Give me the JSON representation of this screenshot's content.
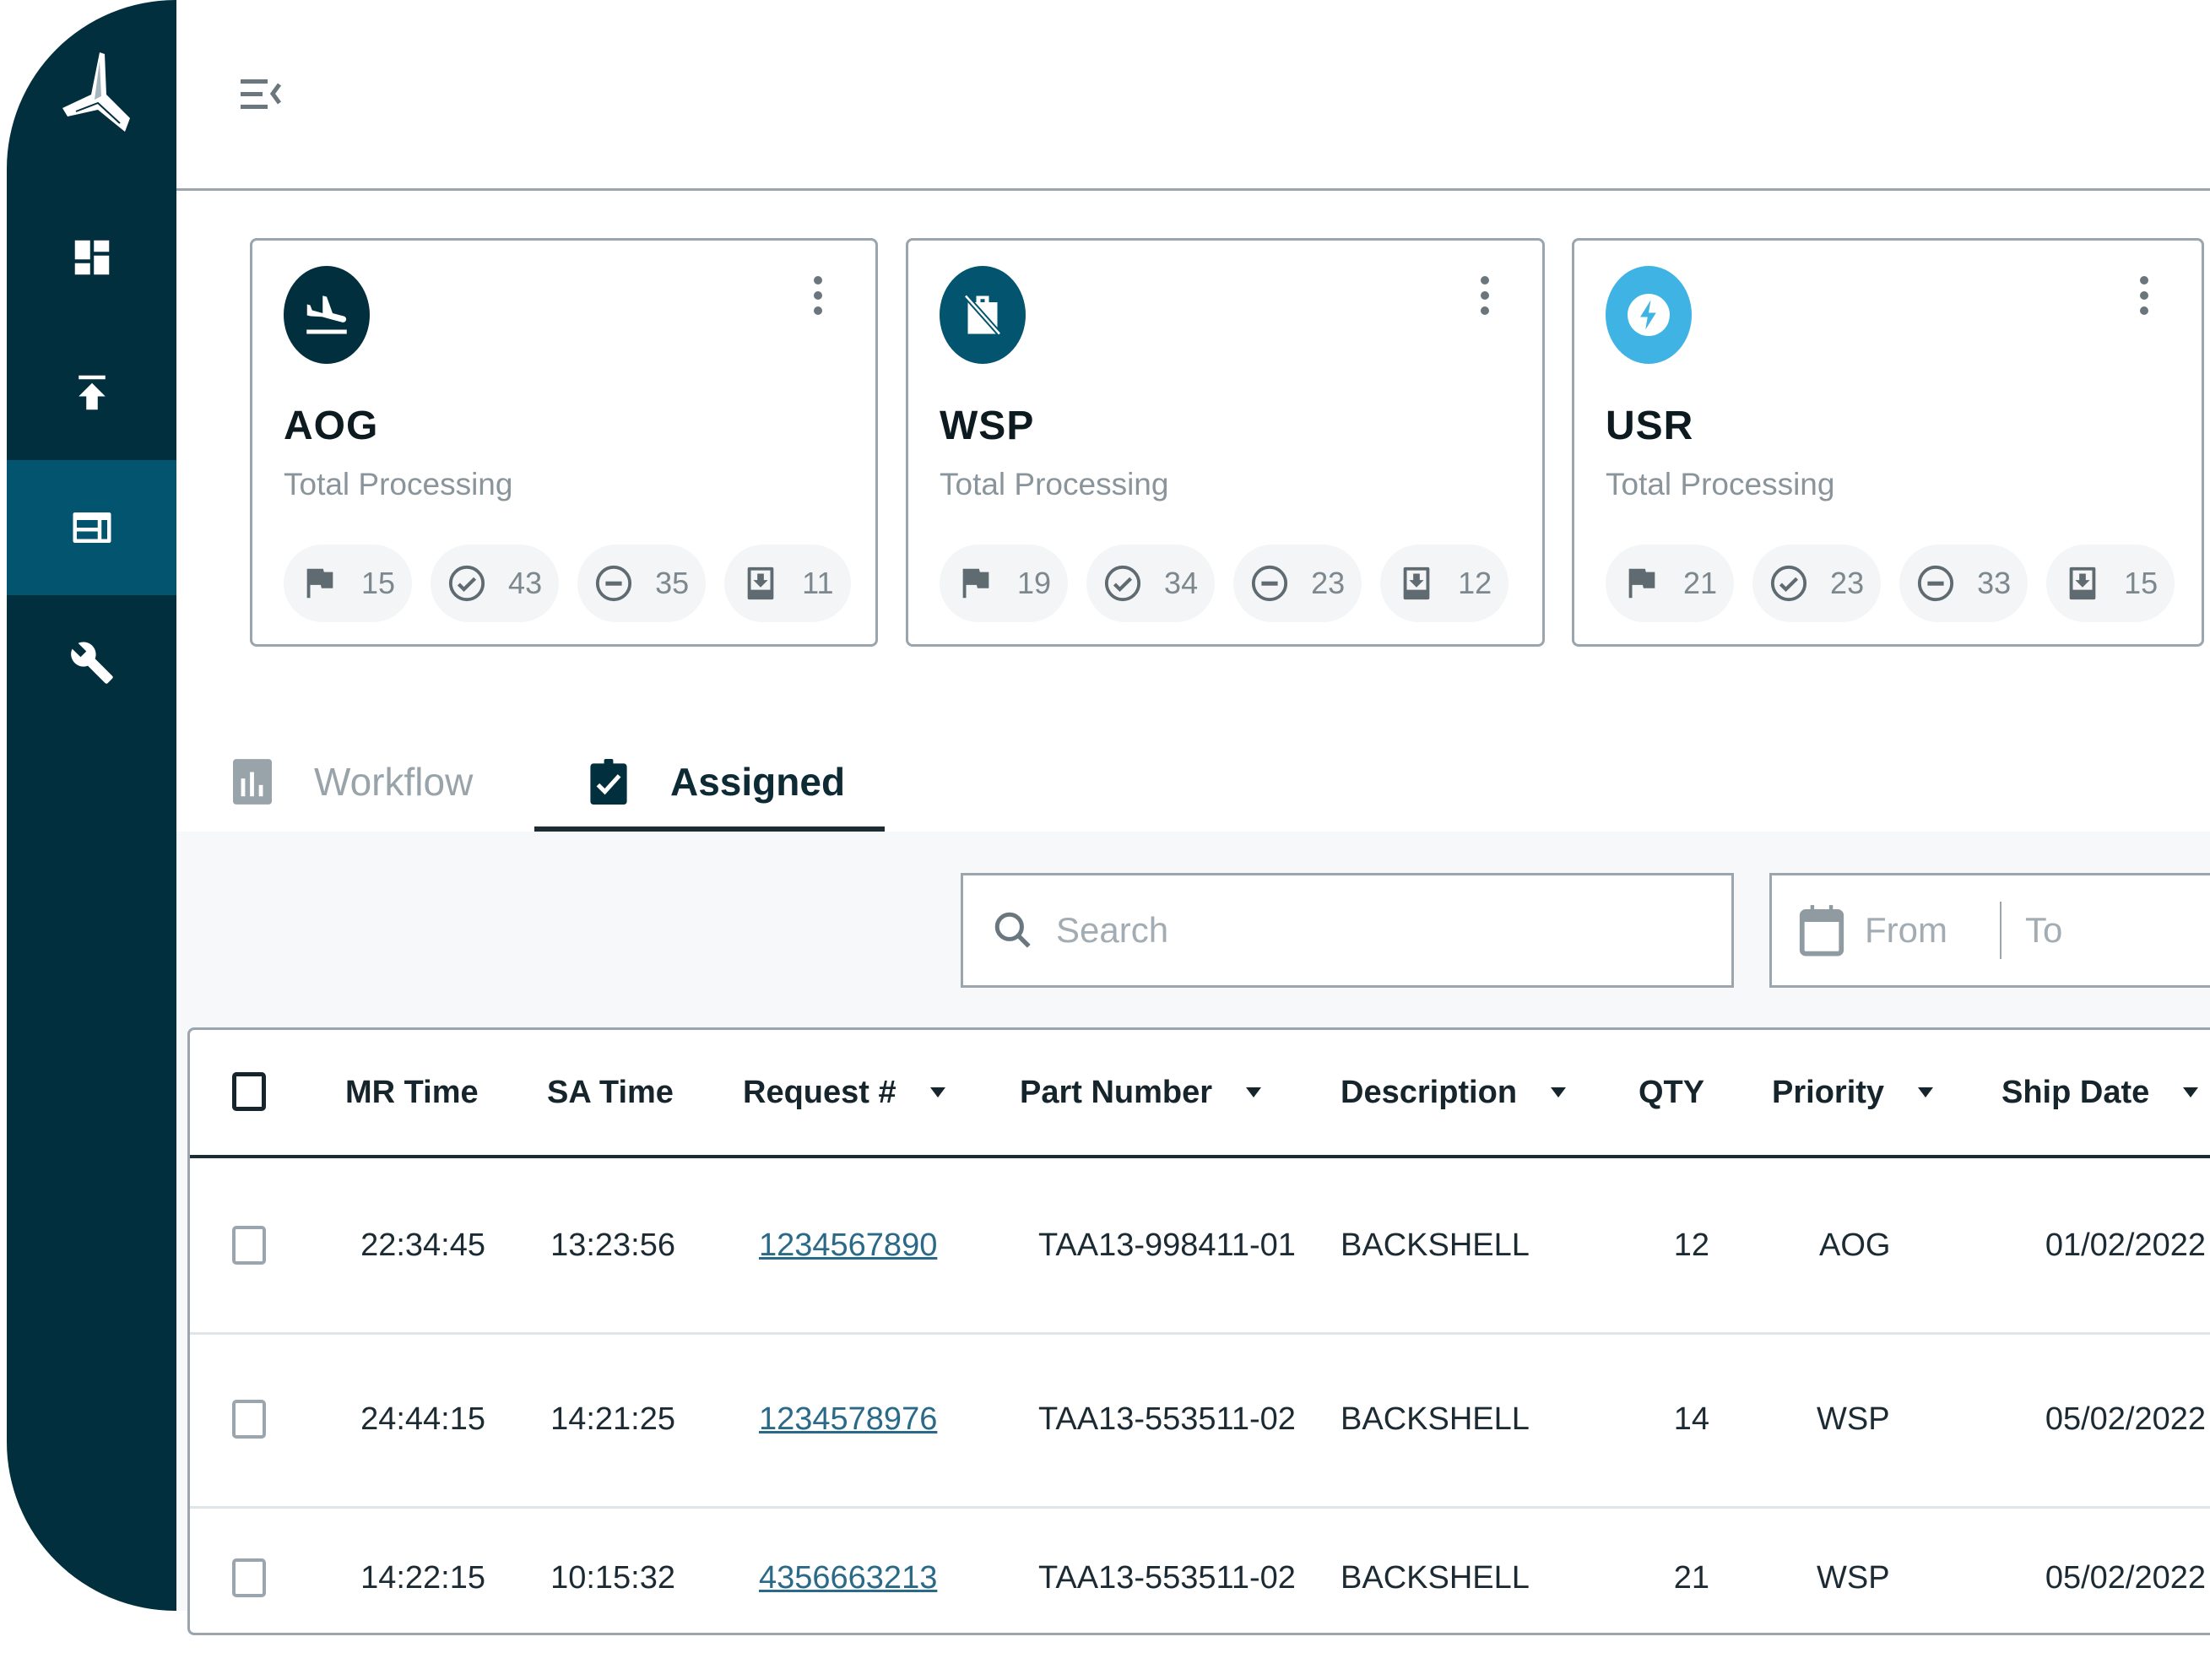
{
  "colors": {
    "sidebar_bg": "#022f3e",
    "sidebar_active": "#02546f",
    "aog_icon_bg": "#022f3e",
    "wsp_icon_bg": "#02546f",
    "usr_icon_bg": "#3fb3e3",
    "link": "#2a6a88"
  },
  "sidebar": {
    "logo": "tri-wing-logo",
    "items": [
      {
        "name": "dashboard",
        "icon": "dashboard-icon",
        "active": false
      },
      {
        "name": "upload",
        "icon": "upload-icon",
        "active": false
      },
      {
        "name": "assignments",
        "icon": "layout-panel-icon",
        "active": true
      },
      {
        "name": "tools",
        "icon": "wrench-icon",
        "active": false
      }
    ]
  },
  "header": {
    "menu_icon": "menu-collapse-icon"
  },
  "cards": [
    {
      "title": "AOG",
      "subtitle": "Total Processing",
      "icon": "flight-land-icon",
      "stats": [
        {
          "icon": "flag-icon",
          "value": "15"
        },
        {
          "icon": "check-circle-icon",
          "value": "43"
        },
        {
          "icon": "minus-circle-icon",
          "value": "35"
        },
        {
          "icon": "download-box-icon",
          "value": "11"
        }
      ]
    },
    {
      "title": "WSP",
      "subtitle": "Total Processing",
      "icon": "no-luggage-icon",
      "stats": [
        {
          "icon": "flag-icon",
          "value": "19"
        },
        {
          "icon": "check-circle-icon",
          "value": "34"
        },
        {
          "icon": "minus-circle-icon",
          "value": "23"
        },
        {
          "icon": "download-box-icon",
          "value": "12"
        }
      ]
    },
    {
      "title": "USR",
      "subtitle": "Total Processing",
      "icon": "bolt-circle-icon",
      "stats": [
        {
          "icon": "flag-icon",
          "value": "21"
        },
        {
          "icon": "check-circle-icon",
          "value": "23"
        },
        {
          "icon": "minus-circle-icon",
          "value": "33"
        },
        {
          "icon": "download-box-icon",
          "value": "15"
        }
      ]
    }
  ],
  "tabs": [
    {
      "label": "Workflow",
      "icon": "bar-chart-icon",
      "active": false
    },
    {
      "label": "Assigned",
      "icon": "clipboard-check-icon",
      "active": true
    }
  ],
  "filters": {
    "search_placeholder": "Search",
    "search_value": "",
    "date_from_placeholder": "From",
    "date_to_placeholder": "To"
  },
  "table": {
    "columns": [
      {
        "label": "MR Time",
        "sortable": false
      },
      {
        "label": "SA Time",
        "sortable": false
      },
      {
        "label": "Request #",
        "sortable": true
      },
      {
        "label": "Part Number",
        "sortable": true
      },
      {
        "label": "Description",
        "sortable": true
      },
      {
        "label": "QTY",
        "sortable": false
      },
      {
        "label": "Priority",
        "sortable": true
      },
      {
        "label": "Ship Date",
        "sortable": true
      }
    ],
    "rows": [
      {
        "mr_time": "22:34:45",
        "sa_time": "13:23:56",
        "request": "1234567890",
        "part_number": "TAA13-998411-01",
        "description": "BACKSHELL",
        "qty": "12",
        "priority": "AOG",
        "ship_date": "01/02/2022"
      },
      {
        "mr_time": "24:44:15",
        "sa_time": "14:21:25",
        "request": "1234578976",
        "part_number": "TAA13-553511-02",
        "description": "BACKSHELL",
        "qty": "14",
        "priority": "WSP",
        "ship_date": "05/02/2022"
      },
      {
        "mr_time": "14:22:15",
        "sa_time": "10:15:32",
        "request": "4356663213",
        "part_number": "TAA13-553511-02",
        "description": "BACKSHELL",
        "qty": "21",
        "priority": "WSP",
        "ship_date": "05/02/2022"
      }
    ]
  }
}
